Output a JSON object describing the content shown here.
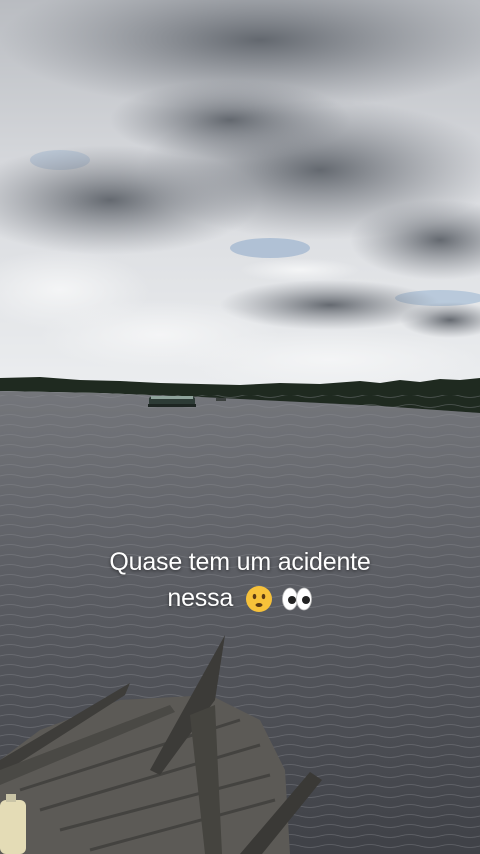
{
  "caption": {
    "line1": "Quase tem um acidente",
    "line2": "nessa"
  },
  "emoji_icons": [
    "worried-face-icon",
    "eyes-icon"
  ],
  "colors": {
    "sky_top": "#c9ccd1",
    "cloud_dark": "#6f747b",
    "water": "#56585f",
    "treeline": "#1f2a20",
    "boat_wood": "#5c5a56",
    "caption_text": "#ffffff"
  }
}
